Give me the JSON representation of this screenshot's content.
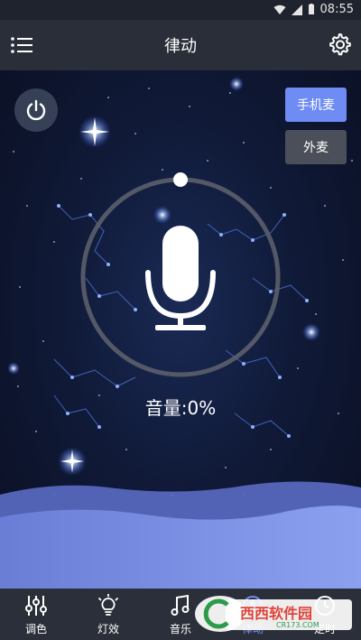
{
  "status_bar": {
    "time": "08:55"
  },
  "app_bar": {
    "title": "律动"
  },
  "modes": {
    "phone_mic": "手机麦",
    "external_mic": "外麦"
  },
  "volume": {
    "text": "音量:0%",
    "value": 0
  },
  "tabs": [
    {
      "label": "调色",
      "icon": "sliders-icon"
    },
    {
      "label": "灯效",
      "icon": "bulb-icon"
    },
    {
      "label": "音乐",
      "icon": "music-note-icon"
    },
    {
      "label": "律动",
      "icon": "rhythm-icon",
      "active": true
    },
    {
      "label": "定时",
      "icon": "clock-icon"
    }
  ],
  "watermark": {
    "brand": "西西软件园",
    "domain": "CR173.COM"
  },
  "colors": {
    "accent": "#6e8cf3",
    "appbar": "#2a2e38",
    "tabbar": "#2b2f3a"
  }
}
